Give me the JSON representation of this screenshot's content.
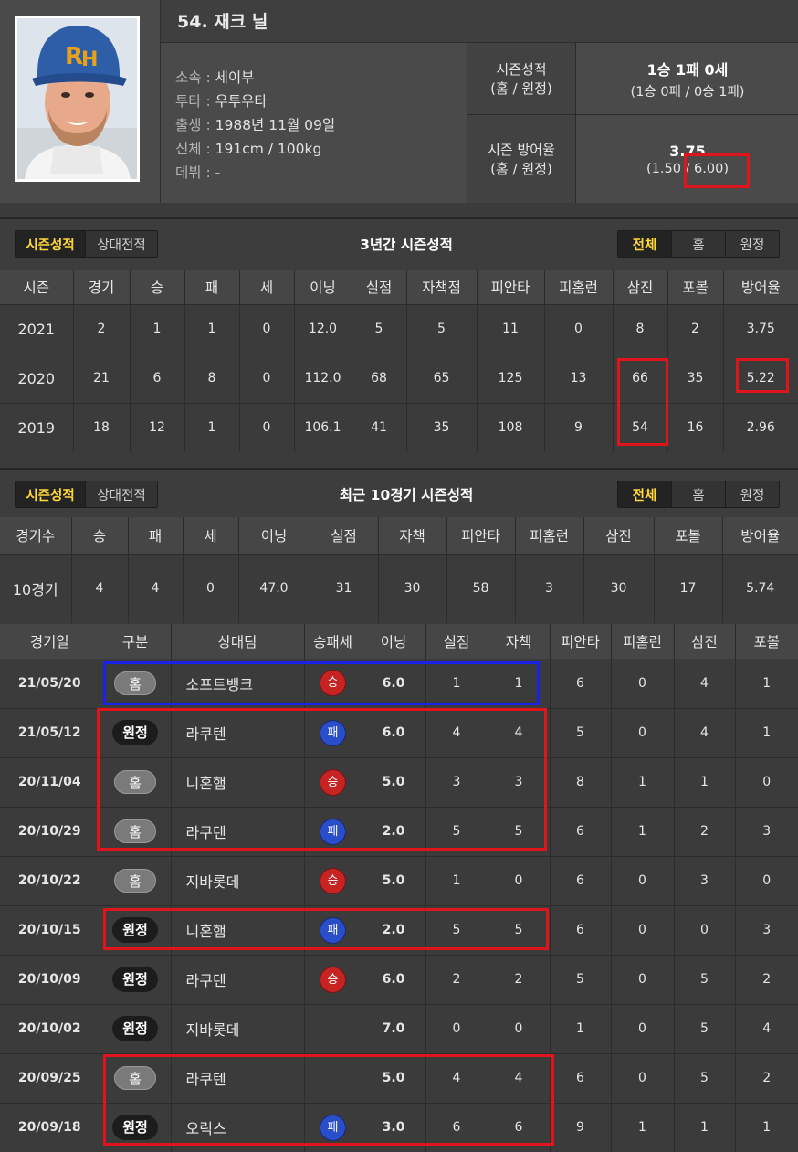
{
  "profile": {
    "name": "54. 재크 닐",
    "rows": [
      {
        "key": "소속",
        "value": "세이부"
      },
      {
        "key": "투타",
        "value": "우투우타"
      },
      {
        "key": "출생",
        "value": "1988년 11월 09일"
      },
      {
        "key": "신체",
        "value": "191cm / 100kg"
      },
      {
        "key": "데뷔",
        "value": "-"
      }
    ],
    "season_record": {
      "label1": "시즌성적",
      "label2": "(홈 / 원정)",
      "main": "1승 1패 0세",
      "sub": "(1승 0패 / 0승 1패)"
    },
    "season_era": {
      "label1": "시즌 방어율",
      "label2": "(홈 / 원정)",
      "main": "3.75",
      "sub": "(1.50 / 6.00)"
    }
  },
  "colors": {
    "accent": "#ffd83a",
    "win": "#c82323",
    "loss": "#2a4ec9",
    "highlight_red": "#e0141b",
    "highlight_blue": "#1b22e8"
  },
  "tabs": {
    "season": "시즌성적",
    "versus": "상대전적"
  },
  "filters": {
    "all": "전체",
    "home": "홈",
    "away": "원정"
  },
  "three_year": {
    "title": "3년간 시즌성적",
    "headers": [
      "시즌",
      "경기",
      "승",
      "패",
      "세",
      "이닝",
      "실점",
      "자책점",
      "피안타",
      "피홈런",
      "삼진",
      "포볼",
      "방어율"
    ],
    "rows": [
      [
        "2021",
        "2",
        "1",
        "1",
        "0",
        "12.0",
        "5",
        "5",
        "11",
        "0",
        "8",
        "2",
        "3.75"
      ],
      [
        "2020",
        "21",
        "6",
        "8",
        "0",
        "112.0",
        "68",
        "65",
        "125",
        "13",
        "66",
        "35",
        "5.22"
      ],
      [
        "2019",
        "18",
        "12",
        "1",
        "0",
        "106.1",
        "41",
        "35",
        "108",
        "9",
        "54",
        "16",
        "2.96"
      ]
    ]
  },
  "recent": {
    "title": "최근 10경기 시즌성적",
    "summary_headers": [
      "경기수",
      "승",
      "패",
      "세",
      "이닝",
      "실점",
      "자책",
      "피안타",
      "피홈런",
      "삼진",
      "포볼",
      "방어율"
    ],
    "summary_row": [
      "10경기",
      "4",
      "4",
      "0",
      "47.0",
      "31",
      "30",
      "58",
      "3",
      "30",
      "17",
      "5.74"
    ],
    "game_headers": [
      "경기일",
      "구분",
      "상대팀",
      "승패세",
      "이닝",
      "실점",
      "자책",
      "피안타",
      "피홈런",
      "삼진",
      "포볼"
    ],
    "games": [
      {
        "date": "21/05/20",
        "venue": "홈",
        "opp": "소프트뱅크",
        "res": "승",
        "ip": "6.0",
        "r": "1",
        "er": "1",
        "h": "6",
        "hr": "0",
        "so": "4",
        "bb": "1"
      },
      {
        "date": "21/05/12",
        "venue": "원정",
        "opp": "라쿠텐",
        "res": "패",
        "ip": "6.0",
        "r": "4",
        "er": "4",
        "h": "5",
        "hr": "0",
        "so": "4",
        "bb": "1"
      },
      {
        "date": "20/11/04",
        "venue": "홈",
        "opp": "니혼햄",
        "res": "승",
        "ip": "5.0",
        "r": "3",
        "er": "3",
        "h": "8",
        "hr": "1",
        "so": "1",
        "bb": "0"
      },
      {
        "date": "20/10/29",
        "venue": "홈",
        "opp": "라쿠텐",
        "res": "패",
        "ip": "2.0",
        "r": "5",
        "er": "5",
        "h": "6",
        "hr": "1",
        "so": "2",
        "bb": "3"
      },
      {
        "date": "20/10/22",
        "venue": "홈",
        "opp": "지바롯데",
        "res": "승",
        "ip": "5.0",
        "r": "1",
        "er": "0",
        "h": "6",
        "hr": "0",
        "so": "3",
        "bb": "0"
      },
      {
        "date": "20/10/15",
        "venue": "원정",
        "opp": "니혼햄",
        "res": "패",
        "ip": "2.0",
        "r": "5",
        "er": "5",
        "h": "6",
        "hr": "0",
        "so": "0",
        "bb": "3"
      },
      {
        "date": "20/10/09",
        "venue": "원정",
        "opp": "라쿠텐",
        "res": "승",
        "ip": "6.0",
        "r": "2",
        "er": "2",
        "h": "5",
        "hr": "0",
        "so": "5",
        "bb": "2"
      },
      {
        "date": "20/10/02",
        "venue": "원정",
        "opp": "지바롯데",
        "res": "",
        "ip": "7.0",
        "r": "0",
        "er": "0",
        "h": "1",
        "hr": "0",
        "so": "5",
        "bb": "4"
      },
      {
        "date": "20/09/25",
        "venue": "홈",
        "opp": "라쿠텐",
        "res": "",
        "ip": "5.0",
        "r": "4",
        "er": "4",
        "h": "6",
        "hr": "0",
        "so": "5",
        "bb": "2"
      },
      {
        "date": "20/09/18",
        "venue": "원정",
        "opp": "오릭스",
        "res": "패",
        "ip": "3.0",
        "r": "6",
        "er": "6",
        "h": "9",
        "hr": "1",
        "so": "1",
        "bb": "1"
      }
    ]
  }
}
